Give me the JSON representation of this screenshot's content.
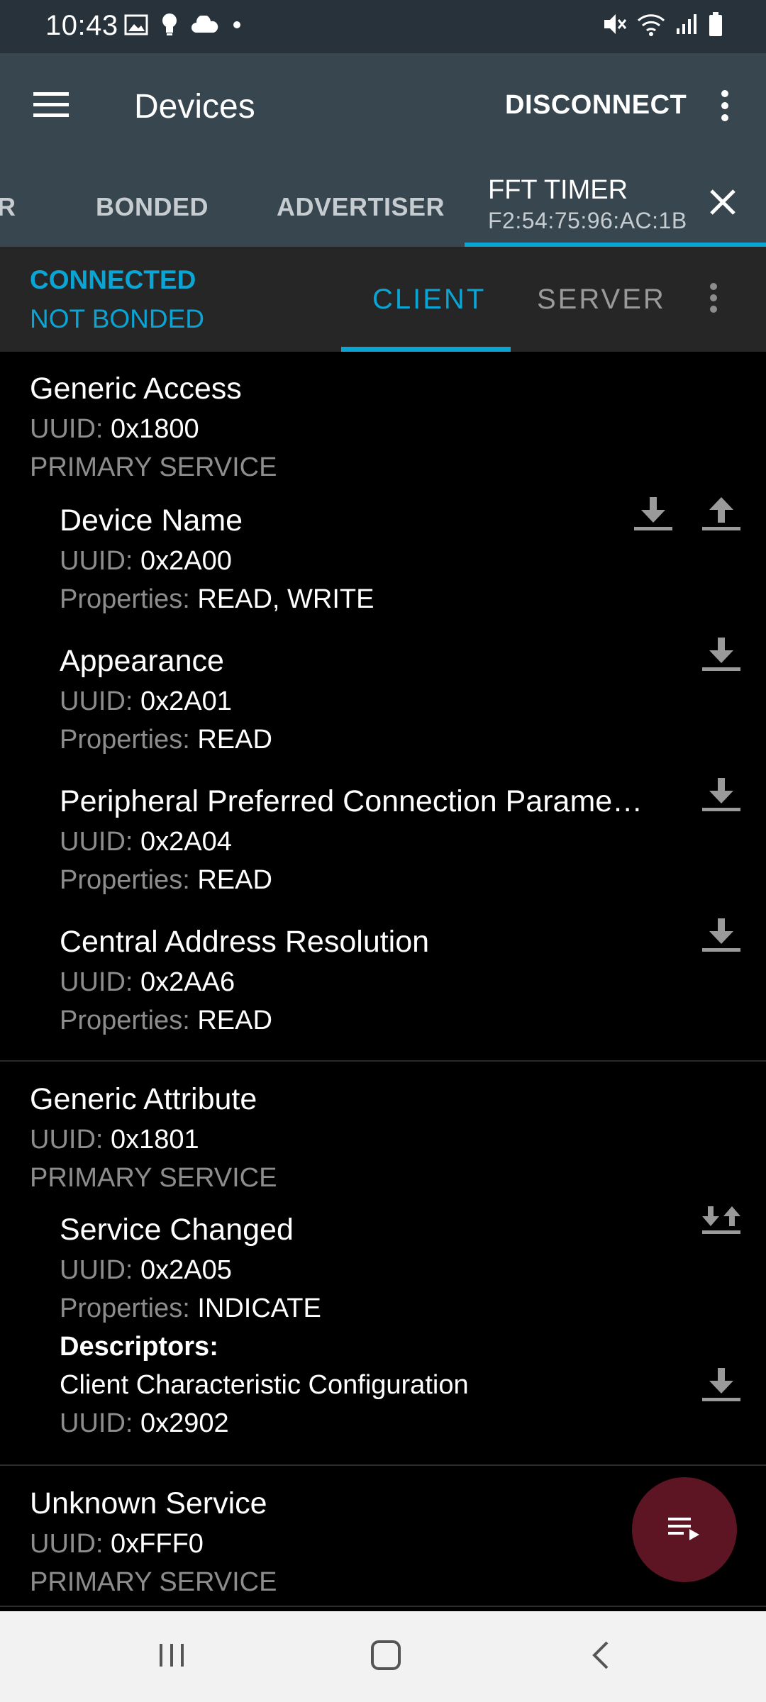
{
  "status_bar": {
    "time": "10:43",
    "left_icons": [
      "image-icon",
      "bulb-icon",
      "cloud-icon",
      "dot-icon"
    ],
    "right_icons": [
      "mute-icon",
      "wifi-icon",
      "signal-icon",
      "battery-icon"
    ]
  },
  "app_bar": {
    "title": "Devices",
    "disconnect_label": "DISCONNECT"
  },
  "device_tabs": {
    "partial_tab": "R",
    "bonded": "BONDED",
    "advertiser": "ADVERTISER",
    "active": {
      "name": "FFT TIMER",
      "address": "F2:54:75:96:AC:1B"
    }
  },
  "connection": {
    "state": "CONNECTED",
    "bond_state": "NOT BONDED",
    "tabs": [
      "CLIENT",
      "SERVER"
    ],
    "active_tab": "CLIENT"
  },
  "labels": {
    "uuid": "UUID:",
    "properties": "Properties:",
    "descriptors": "Descriptors:"
  },
  "services": [
    {
      "name": "Generic Access",
      "uuid": "0x1800",
      "type": "PRIMARY SERVICE",
      "characteristics": [
        {
          "name": "Device Name",
          "uuid": "0x2A00",
          "properties": "READ, WRITE"
        },
        {
          "name": "Appearance",
          "uuid": "0x2A01",
          "properties": "READ"
        },
        {
          "name": "Peripheral Preferred Connection Parame…",
          "uuid": "0x2A04",
          "properties": "READ"
        },
        {
          "name": "Central Address Resolution",
          "uuid": "0x2AA6",
          "properties": "READ"
        }
      ]
    },
    {
      "name": "Generic Attribute",
      "uuid": "0x1801",
      "type": "PRIMARY SERVICE",
      "characteristics": [
        {
          "name": "Service Changed",
          "uuid": "0x2A05",
          "properties": "INDICATE",
          "descriptors": [
            {
              "name": "Client Characteristic Configuration",
              "uuid": "0x2902"
            }
          ]
        }
      ]
    },
    {
      "name": "Unknown Service",
      "uuid": "0xFFF0",
      "type": "PRIMARY SERVICE"
    }
  ],
  "colors": {
    "accent": "#0aa5d5",
    "app_bar": "#37464f",
    "status_bar": "#27323b",
    "fab": "#5d1523"
  }
}
